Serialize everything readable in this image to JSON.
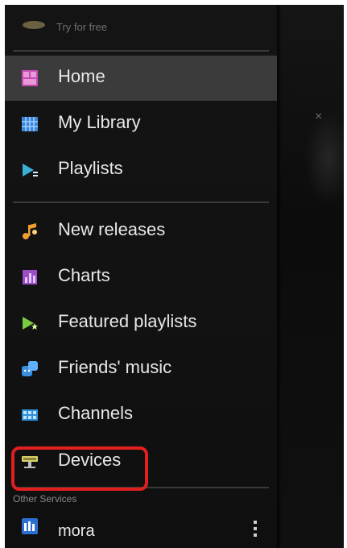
{
  "trial": {
    "text": "Try for free"
  },
  "menu": [
    {
      "id": "home",
      "label": "Home",
      "icon": "home-icon",
      "active": true
    },
    {
      "id": "my-library",
      "label": "My Library",
      "icon": "library-icon"
    },
    {
      "id": "playlists",
      "label": "Playlists",
      "icon": "playlists-icon"
    },
    {
      "id": "new-releases",
      "label": "New releases",
      "icon": "new-releases-icon"
    },
    {
      "id": "charts",
      "label": "Charts",
      "icon": "charts-icon"
    },
    {
      "id": "featured-playlists",
      "label": "Featured playlists",
      "icon": "featured-playlists-icon"
    },
    {
      "id": "friends-music",
      "label": "Friends' music",
      "icon": "friends-music-icon"
    },
    {
      "id": "channels",
      "label": "Channels",
      "icon": "channels-icon"
    },
    {
      "id": "devices",
      "label": "Devices",
      "icon": "devices-icon",
      "highlighted": true
    }
  ],
  "other_services": {
    "header": "Other Services",
    "items": [
      {
        "id": "mora",
        "label": "mora",
        "icon": "mora-icon"
      }
    ]
  },
  "colors": {
    "highlight": "#e01f1f",
    "active_bg": "#3b3b3b",
    "drawer_bg": "#131313"
  }
}
